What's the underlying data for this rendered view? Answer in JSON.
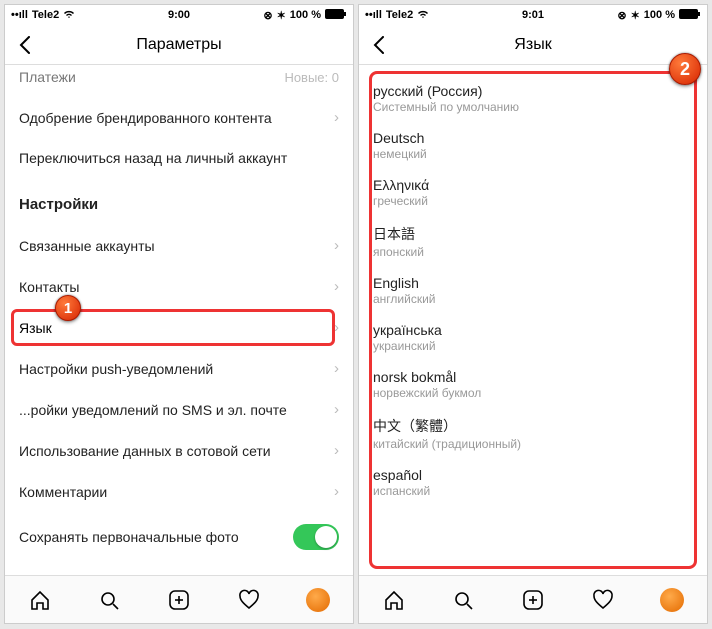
{
  "left": {
    "status": {
      "carrier": "Tele2",
      "time": "9:00",
      "battery": "100 %"
    },
    "nav": {
      "title": "Параметры"
    },
    "rows": {
      "payments": {
        "label": "Платежи",
        "meta": "Новые: 0"
      },
      "branded": "Одобрение брендированного контента",
      "switchback": "Переключиться назад на личный аккаунт",
      "section": "Настройки",
      "linked": "Связанные аккаунты",
      "contacts": "Контакты",
      "language": "Язык",
      "push": "Настройки push-уведомлений",
      "sms": "...ройки уведомлений по SMS и эл. почте",
      "data": "Использование данных в сотовой сети",
      "comments": "Комментарии",
      "savephoto": "Сохранять первоначальные фото"
    },
    "badge": "1"
  },
  "right": {
    "status": {
      "carrier": "Tele2",
      "time": "9:01",
      "battery": "100 %"
    },
    "nav": {
      "title": "Язык"
    },
    "langs": [
      {
        "native": "русский (Россия)",
        "translated": "Системный по умолчанию"
      },
      {
        "native": "Deutsch",
        "translated": "немецкий"
      },
      {
        "native": "Ελληνικά",
        "translated": "греческий"
      },
      {
        "native": "日本語",
        "translated": "японский"
      },
      {
        "native": "English",
        "translated": "английский"
      },
      {
        "native": "українська",
        "translated": "украинский"
      },
      {
        "native": "norsk bokmål",
        "translated": "норвежский букмол"
      },
      {
        "native": "中文（繁體）",
        "translated": "китайский (традиционный)"
      },
      {
        "native": "español",
        "translated": "испанский"
      }
    ],
    "badge": "2"
  }
}
